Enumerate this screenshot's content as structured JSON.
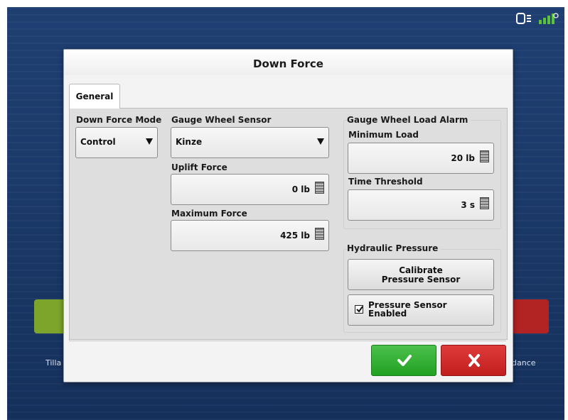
{
  "background": {
    "left_tile_label": "Tilla",
    "right_tile_label": "dance"
  },
  "status_icons": [
    "display-icon",
    "gps-signal-icon"
  ],
  "dialog": {
    "title": "Down Force",
    "tabs": [
      {
        "label": "General",
        "selected": true
      }
    ],
    "down_force_mode": {
      "label": "Down Force Mode",
      "value": "Control"
    },
    "gauge_wheel_sensor": {
      "label": "Gauge Wheel Sensor",
      "value": "Kinze"
    },
    "uplift_force": {
      "label": "Uplift Force",
      "value": "0 lb"
    },
    "maximum_force": {
      "label": "Maximum Force",
      "value": "425 lb"
    },
    "gauge_wheel_load_alarm": {
      "title": "Gauge Wheel Load Alarm",
      "minimum_load": {
        "label": "Minimum Load",
        "value": "20 lb"
      },
      "time_threshold": {
        "label": "Time Threshold",
        "value": "3 s"
      }
    },
    "hydraulic_pressure": {
      "title": "Hydraulic Pressure",
      "calibrate_line1": "Calibrate",
      "calibrate_line2": "Pressure Sensor",
      "enabled_line1": "Pressure Sensor",
      "enabled_line2": "Enabled",
      "enabled_checked": true
    }
  },
  "colors": {
    "ok": "#2aa82a",
    "cancel": "#cc2222",
    "screen_bg": "#1f3f73"
  }
}
